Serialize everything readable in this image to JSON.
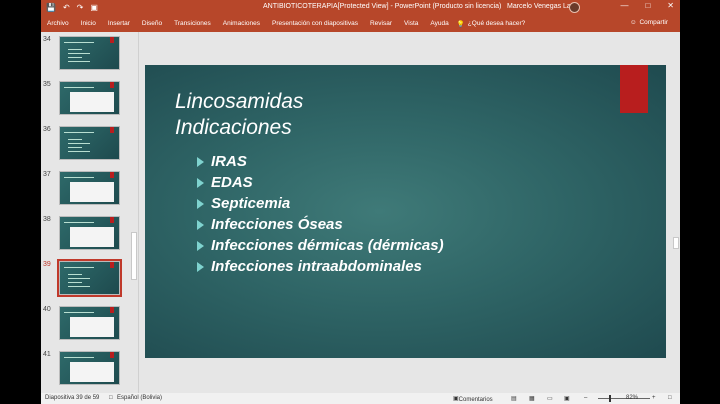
{
  "titlebar": {
    "qa_icons": [
      "save-icon",
      "undo-icon",
      "redo-icon",
      "present-icon"
    ],
    "qa_glyphs": [
      "💾",
      "↶",
      "↷",
      "▣"
    ],
    "doc_title": "ANTIBIOTICOTERAPIA[Protected View] - PowerPoint (Producto sin licencia)",
    "user": "Marcelo Venegas Lazo",
    "window_buttons": [
      "—",
      "□",
      "✕"
    ]
  },
  "ribbon": {
    "tabs": [
      "Archivo",
      "Inicio",
      "Insertar",
      "Diseño",
      "Transiciones",
      "Animaciones",
      "Presentación con diapositivas",
      "Revisar",
      "Vista",
      "Ayuda"
    ],
    "tell_me": "¿Qué desea hacer?",
    "share": "Compartir"
  },
  "thumbnails": [
    {
      "num": "34",
      "kind": "text"
    },
    {
      "num": "35",
      "kind": "table"
    },
    {
      "num": "36",
      "kind": "text"
    },
    {
      "num": "37",
      "kind": "table"
    },
    {
      "num": "38",
      "kind": "table"
    },
    {
      "num": "39",
      "kind": "text",
      "active": true
    },
    {
      "num": "40",
      "kind": "table"
    },
    {
      "num": "41",
      "kind": "table"
    }
  ],
  "slide": {
    "title_line1": "Lincosamidas",
    "title_line2": "Indicaciones",
    "bullets": [
      "IRAS",
      "EDAS",
      "Septicemia",
      "Infecciones Óseas",
      "Infecciones dérmicas (dérmicas)",
      "Infecciones intraabdominales"
    ]
  },
  "status": {
    "slide_info": "Diapositiva 39 de 59",
    "language": "Español (Bolivia)",
    "comments": "Comentarios",
    "zoom": "82%"
  },
  "colors": {
    "accent": "#b7472a",
    "slide_bg": "#2f6566",
    "slide_red": "#b81e1e"
  }
}
